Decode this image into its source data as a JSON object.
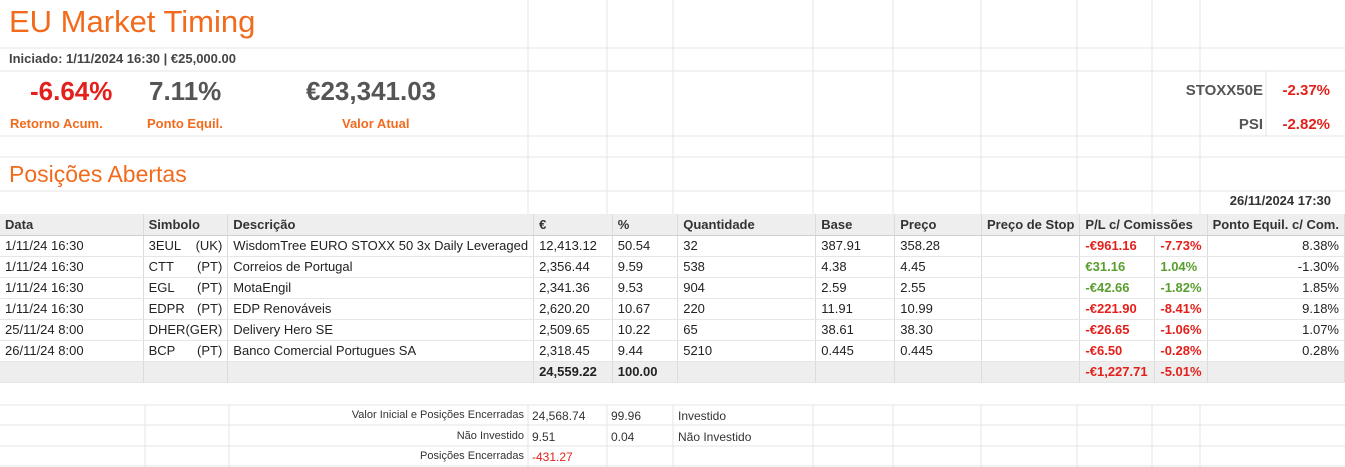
{
  "title": "EU Market Timing",
  "started": "Iniciado: 1/11/2024 16:30 |  €25,000.00",
  "kpis": [
    {
      "value": "-6.64%",
      "label": "Retorno Acum.",
      "color": "#e3201b"
    },
    {
      "value": "7.11%",
      "label": "Ponto Equil.",
      "color": "#555555"
    },
    {
      "value": "€23,341.03",
      "label": "Valor Atual",
      "color": "#555555"
    }
  ],
  "indices": [
    {
      "name": "STOXX50E",
      "value": "-2.37%"
    },
    {
      "name": "PSI",
      "value": "-2.82%"
    }
  ],
  "section_title": "Posições Abertas",
  "as_of": "26/11/2024 17:30",
  "headers": [
    "Data",
    "Simbolo",
    "Descrição",
    "€",
    "%",
    "Quantidade",
    "Base",
    "Preço",
    "Preço de Stop",
    "P/L c/ Comissões",
    "Ponto Equil. c/ Com."
  ],
  "rows": [
    {
      "date": "1/11/24 16:30",
      "symbol": "3EUL",
      "market": "(UK)",
      "desc": "WisdomTree EURO STOXX 50 3x Daily Leveraged",
      "eur": "12,413.12",
      "pct": "50.54",
      "qty": "32",
      "base": "387.91",
      "price": "358.28",
      "stop": "",
      "pl": "-€961.16",
      "pl_pct": "-7.73%",
      "pl_sign": "neg",
      "be": "8.38%"
    },
    {
      "date": "1/11/24 16:30",
      "symbol": "CTT",
      "market": "(PT)",
      "desc": "Correios de Portugal",
      "eur": "2,356.44",
      "pct": "9.59",
      "qty": "538",
      "base": "4.38",
      "price": "4.45",
      "stop": "",
      "pl": "€31.16",
      "pl_pct": "1.04%",
      "pl_sign": "pos",
      "be": "-1.30%"
    },
    {
      "date": "1/11/24 16:30",
      "symbol": "EGL",
      "market": "(PT)",
      "desc": "MotaEngil",
      "eur": "2,341.36",
      "pct": "9.53",
      "qty": "904",
      "base": "2.59",
      "price": "2.55",
      "stop": "",
      "pl": "-€42.66",
      "pl_pct": "-1.82%",
      "pl_sign": "pos",
      "be": "1.85%"
    },
    {
      "date": "1/11/24 16:30",
      "symbol": "EDPR",
      "market": "(PT)",
      "desc": "EDP Renováveis",
      "eur": "2,620.20",
      "pct": "10.67",
      "qty": "220",
      "base": "11.91",
      "price": "10.99",
      "stop": "",
      "pl": "-€221.90",
      "pl_pct": "-8.41%",
      "pl_sign": "neg",
      "be": "9.18%"
    },
    {
      "date": "25/11/24 8:00",
      "symbol": "DHER",
      "market": "(GER)",
      "desc": "Delivery Hero SE",
      "eur": "2,509.65",
      "pct": "10.22",
      "qty": "65",
      "base": "38.61",
      "price": "38.30",
      "stop": "",
      "pl": "-€26.65",
      "pl_pct": "-1.06%",
      "pl_sign": "neg",
      "be": "1.07%"
    },
    {
      "date": "26/11/24 8:00",
      "symbol": "BCP",
      "market": "(PT)",
      "desc": "Banco Comercial Portugues SA",
      "eur": "2,318.45",
      "pct": "9.44",
      "qty": "5210",
      "base": "0.445",
      "price": "0.445",
      "stop": "",
      "pl": "-€6.50",
      "pl_pct": "-0.28%",
      "pl_sign": "neg",
      "be": "0.28%"
    }
  ],
  "totals": {
    "eur": "24,559.22",
    "pct": "100.00",
    "pl": "-€1,227.71",
    "pl_pct": "-5.01%"
  },
  "footer": [
    {
      "label": "Valor Inicial e Posições Encerradas",
      "value": "24,568.74",
      "pct": "99.96",
      "note": "Investido",
      "value_color": "#333333"
    },
    {
      "label": "Não Investido",
      "value": "9.51",
      "pct": "0.04",
      "note": "Não Investido",
      "value_color": "#333333"
    },
    {
      "label": "Posições Encerradas",
      "value": "-431.27",
      "pct": "",
      "note": "",
      "value_color": "#e3201b"
    }
  ]
}
